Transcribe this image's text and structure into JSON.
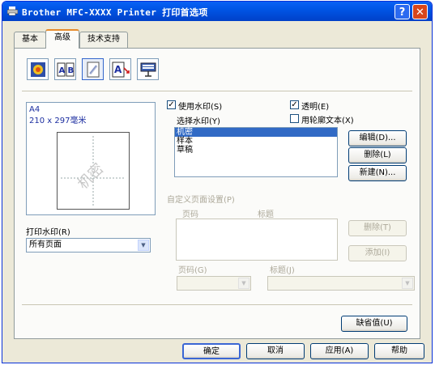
{
  "window": {
    "title": "Brother MFC-XXXX Printer 打印首选项",
    "help_symbol": "?",
    "close_symbol": "✕"
  },
  "tabs": [
    {
      "label": "基本"
    },
    {
      "label": "高级"
    },
    {
      "label": "技术支持"
    }
  ],
  "toolbar_icons": [
    "quality-icon",
    "duplex-icon",
    "watermark-icon",
    "scaling-icon",
    "device-options-icon"
  ],
  "preview": {
    "paper_size": "A4",
    "dimensions": "210 x 297毫米",
    "watermark_text": "机密"
  },
  "print_watermark": {
    "label": "打印水印(R)",
    "value": "所有页面"
  },
  "watermark": {
    "use_label": "使用水印(S)",
    "use_checked": "✓",
    "transparent_label": "透明(E)",
    "transparent_checked": "✓",
    "outline_label": "用轮廓文本(X)",
    "outline_checked": "",
    "select_label": "选择水印(Y)",
    "items": [
      "机密",
      "样本",
      "草稿"
    ],
    "edit_button": "编辑(D)...",
    "delete_button": "删除(L)",
    "new_button": "新建(N)..."
  },
  "custom_page": {
    "label": "自定义页面设置(P)",
    "col_page": "页码",
    "col_title": "标题",
    "delete_button": "删除(T)",
    "add_button": "添加(I)",
    "page_label": "页码(G)",
    "title_label": "标题(J)",
    "page_value": "",
    "title_value": ""
  },
  "defaults_button": "缺省值(U)",
  "footer": {
    "ok": "确定",
    "cancel": "取消",
    "apply": "应用(A)",
    "help": "帮助"
  }
}
